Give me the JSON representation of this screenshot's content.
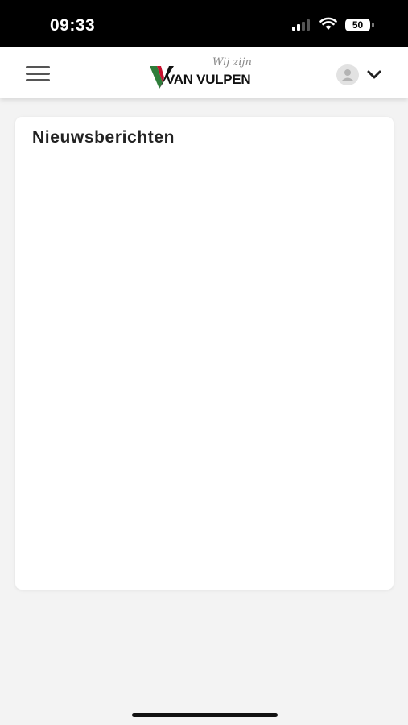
{
  "status_bar": {
    "time": "09:33",
    "battery": "50",
    "icons": [
      "signal-icon",
      "wifi-icon",
      "battery-icon"
    ]
  },
  "header": {
    "menu_icon": "hamburger-menu-icon",
    "logo": {
      "brand": "VAN VULPEN",
      "tagline": "Wij zijn",
      "colors": {
        "green": "#2e7d3a",
        "red": "#c8102e",
        "dark": "#111111"
      }
    },
    "account_icon": "user-avatar-icon",
    "dropdown_icon": "chevron-down-icon"
  },
  "main": {
    "news_card": {
      "title": "Nieuwsberichten"
    }
  },
  "colors": {
    "page_background": "#f3f3f3",
    "card_background": "#ffffff",
    "status_bar": "#000000"
  }
}
